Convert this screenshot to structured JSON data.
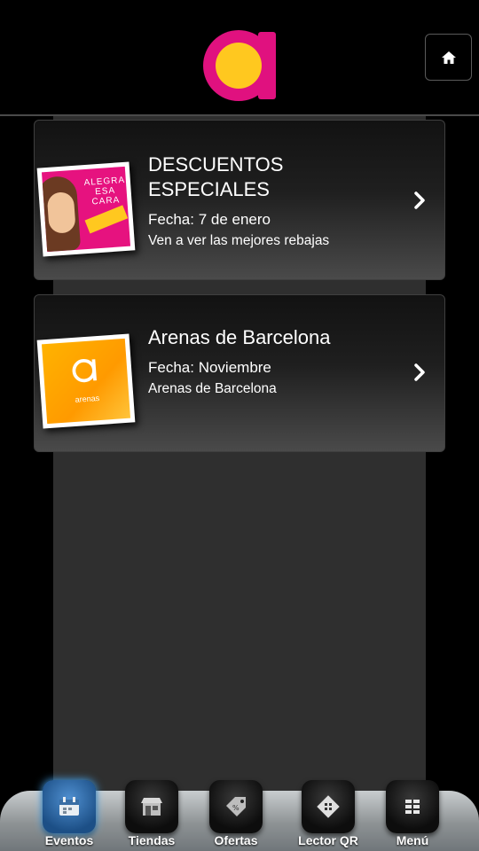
{
  "colors": {
    "brand_magenta": "#e0117f",
    "brand_yellow": "#ffc81f",
    "tab_active": "#2f6fb5"
  },
  "header": {
    "logo_icon": "arenas-logo-icon",
    "home_icon": "home-icon"
  },
  "events": [
    {
      "title_line1": "DESCUENTOS",
      "title_line2": "ESPECIALES",
      "date": "Fecha: 7 de enero",
      "description": "Ven a ver las mejores rebajas",
      "thumb_text": [
        "ALEGRA",
        "ESA",
        "CARA"
      ]
    },
    {
      "title": "Arenas de Barcelona",
      "date": "Fecha: Noviembre",
      "description": "Arenas de Barcelona",
      "thumb_text": "arenas"
    }
  ],
  "tabs": [
    {
      "label": "Eventos",
      "icon": "calendar-icon",
      "active": true
    },
    {
      "label": "Tiendas",
      "icon": "store-icon",
      "active": false
    },
    {
      "label": "Ofertas",
      "icon": "tag-icon",
      "active": false
    },
    {
      "label": "Lector QR",
      "icon": "qr-icon",
      "active": false
    },
    {
      "label": "Menú",
      "icon": "menu-grid-icon",
      "active": false
    }
  ]
}
